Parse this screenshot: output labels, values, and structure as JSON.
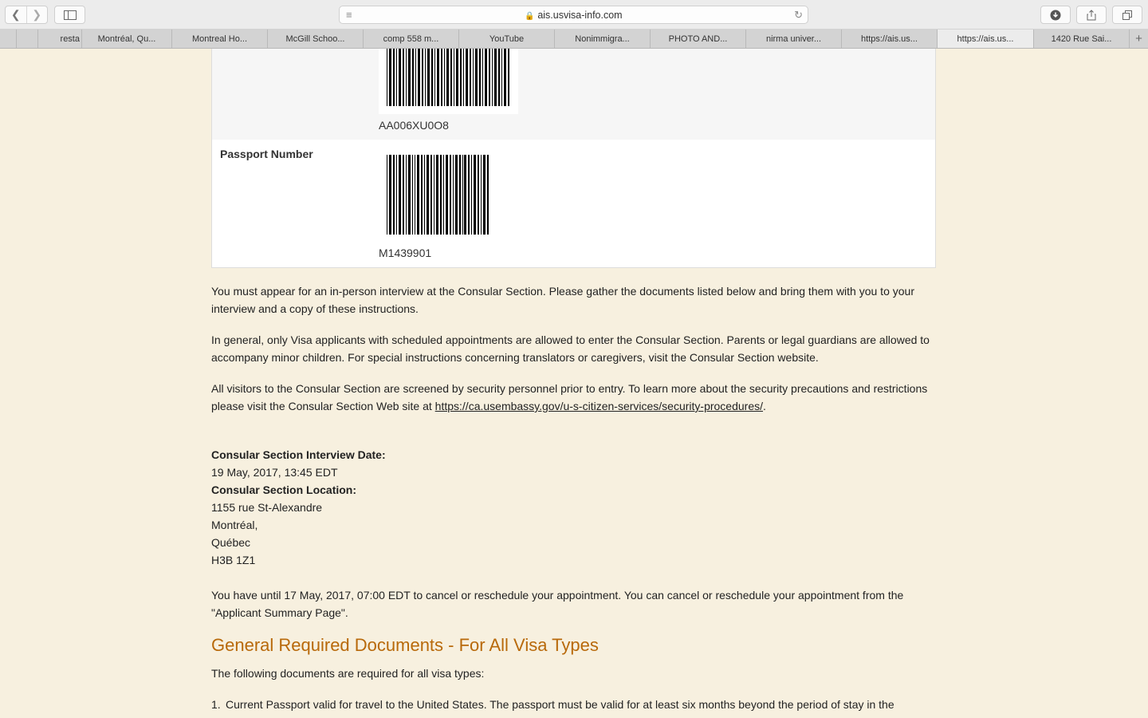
{
  "browser": {
    "url": "ais.usvisa-info.com",
    "tabs": [
      {
        "label": "resta"
      },
      {
        "label": "Montréal, Qu..."
      },
      {
        "label": "Montreal Ho..."
      },
      {
        "label": "McGill Schoo..."
      },
      {
        "label": "comp 558 m..."
      },
      {
        "label": "YouTube"
      },
      {
        "label": "Nonimmigra..."
      },
      {
        "label": "PHOTO AND..."
      },
      {
        "label": "nirma univer..."
      },
      {
        "label": "https://ais.us..."
      },
      {
        "label": "https://ais.us..."
      },
      {
        "label": "1420 Rue Sai..."
      }
    ],
    "active_tab_index": 10,
    "new_tab_symbol": "+"
  },
  "barcode_table": {
    "row1_code": "AA006XU0O8",
    "passport_label": "Passport Number",
    "passport_code": "M1439901"
  },
  "paragraphs": {
    "p1": "You must appear for an in-person interview at the Consular Section. Please gather the documents listed below and bring them with you to your interview and a copy of these instructions.",
    "p2": "In general, only Visa applicants with scheduled appointments are allowed to enter the Consular Section. Parents or legal guardians are allowed to accompany minor children. For special instructions concerning translators or caregivers, visit the Consular Section website.",
    "p3_before": "All visitors to the Consular Section are screened by security personnel prior to entry. To learn more about the security precautions and restrictions please visit the Consular Section Web site at ",
    "p3_link": "https://ca.usembassy.gov/u-s-citizen-services/security-procedures/",
    "p3_after": "."
  },
  "interview": {
    "date_label": "Consular Section Interview Date:",
    "date_value": "19 May, 2017, 13:45 EDT",
    "location_label": "Consular Section Location:",
    "address": [
      "1155 rue St-Alexandre",
      "Montréal,",
      "Québec",
      "H3B 1Z1"
    ]
  },
  "cancel_note": "You have until 17 May, 2017, 07:00 EDT to cancel or reschedule your appointment. You can cancel or reschedule your appointment from the \"Applicant Summary Page\".",
  "documents": {
    "heading": "General Required Documents - For All Visa Types",
    "intro": "The following documents are required for all visa types:",
    "items": [
      {
        "number": "1.",
        "text": "Current Passport valid for travel to the United States. The passport must be valid for at least six months beyond the period of stay in the"
      }
    ]
  },
  "colors": {
    "page_background": "#f7f0df",
    "heading": "#b8690a"
  }
}
